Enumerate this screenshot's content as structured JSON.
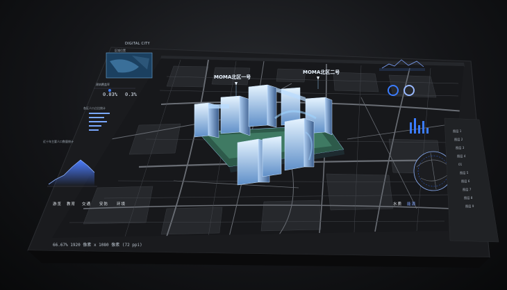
{
  "app": {
    "brand": "DIGITAL CITY",
    "status_bar": "66.67%   1920 像素 x 1080 像素 (72 ppi)"
  },
  "map": {
    "label_tower_1": "MOMA北区一号",
    "label_tower_2": "MOMA北区二号"
  },
  "left_panel": {
    "minimap_title": "区域位置",
    "stat_title": "建筑覆盖率",
    "stat_values": [
      "0.03%",
      "0.3%"
    ],
    "bar_chart_title": "各区人口占比统计",
    "area_chart_title": "近十年主要人口数量统计"
  },
  "nav": {
    "items": [
      "游览",
      "教育",
      "交通",
      "安防",
      "环境"
    ],
    "right_items": [
      "水质",
      "能源"
    ]
  },
  "right_panel": {
    "layers": [
      "图层 1",
      "图层 2",
      "图层 3",
      "图层 4",
      "图层 5",
      "图层 6",
      "图层 7",
      "图层 8",
      "图层 9"
    ],
    "layer_group": "01"
  },
  "colors": {
    "accent": "#3b7cff",
    "glass": "#9fd4ff",
    "map_bg": "#17181b",
    "road": "#6a6e75"
  }
}
